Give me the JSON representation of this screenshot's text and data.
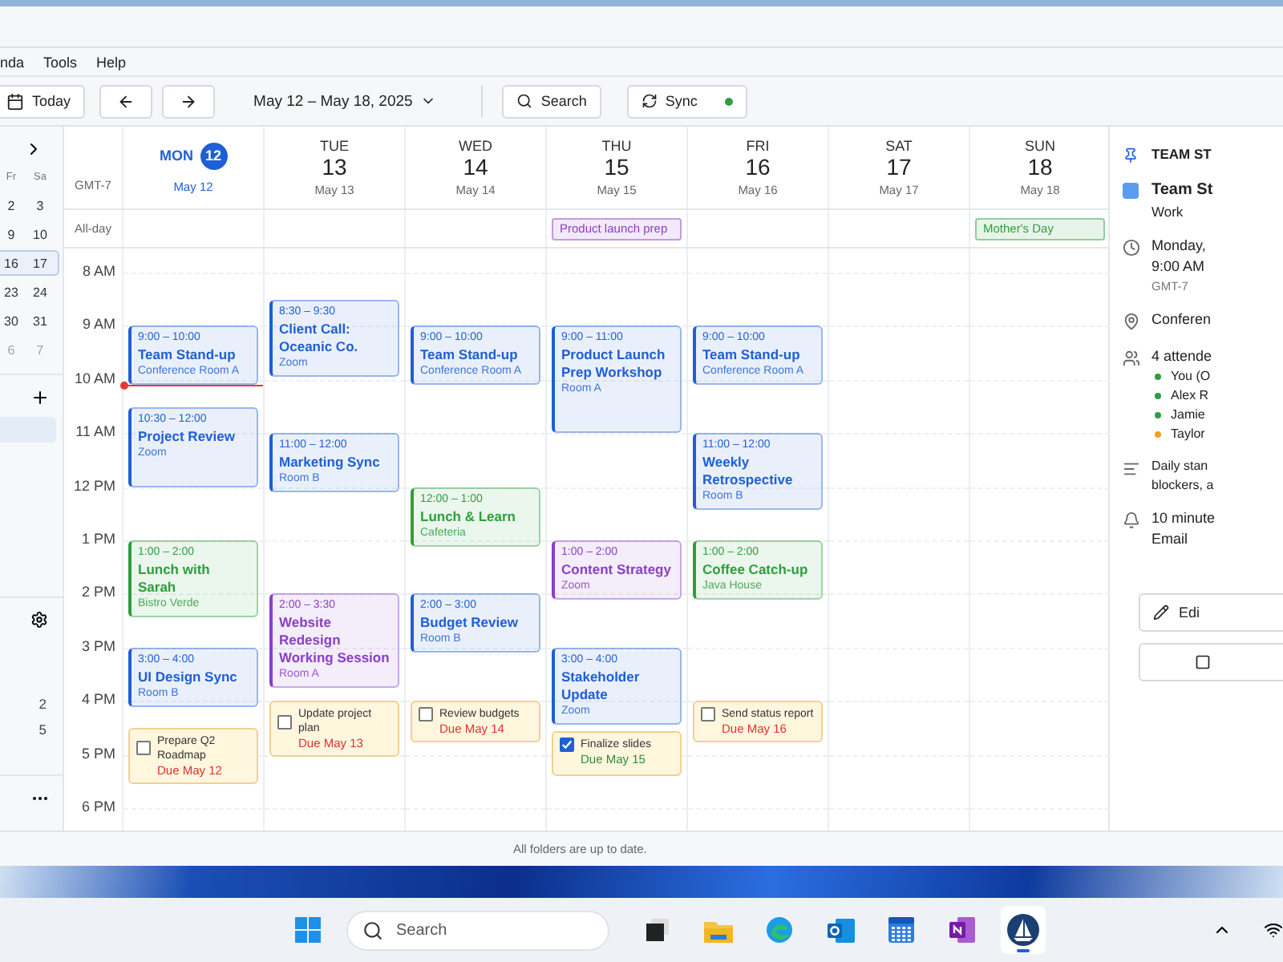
{
  "menu": [
    "nda",
    "Tools",
    "Help"
  ],
  "toolbar": {
    "today": "Today",
    "date_range": "May 12 – May 18, 2025",
    "search": "Search",
    "sync": "Sync",
    "sync_ok": true
  },
  "sidebar": {
    "weekdays": [
      "Fr",
      "Sa"
    ],
    "weeks": [
      {
        "days": [
          "2",
          "3"
        ],
        "selected": false,
        "dimmed": false
      },
      {
        "days": [
          "9",
          "10"
        ],
        "selected": false,
        "dimmed": false
      },
      {
        "days": [
          "16",
          "17"
        ],
        "selected": true,
        "dimmed": false
      },
      {
        "days": [
          "23",
          "24"
        ],
        "selected": false,
        "dimmed": false
      },
      {
        "days": [
          "30",
          "31"
        ],
        "selected": false,
        "dimmed": false
      },
      {
        "days": [
          "6",
          "7"
        ],
        "selected": false,
        "dimmed": true
      }
    ],
    "counts": [
      "2",
      "5"
    ]
  },
  "calendar": {
    "timezone": "GMT-7",
    "allday_label": "All-day",
    "hours": [
      "8 AM",
      "9 AM",
      "10 AM",
      "11 AM",
      "12 PM",
      "1 PM",
      "2 PM",
      "3 PM",
      "4 PM",
      "5 PM",
      "6 PM"
    ],
    "days": [
      {
        "weekday": "MON",
        "number": "12",
        "date": "May 12",
        "selected": true,
        "items": [
          {
            "kind": "event",
            "time": "9:00 – 10:00",
            "title": "Team Stand-up",
            "place": "Conference Room A",
            "color": "#1f5fd6"
          },
          {
            "kind": "event",
            "time": "10:30 – 12:00",
            "title": "Project Review",
            "place": "Zoom",
            "color": "#1f5fd6"
          },
          {
            "kind": "event",
            "time": "1:00 – 2:00",
            "title": "Lunch with Sarah",
            "place": "Bistro Verde",
            "color": "#2e9e3e"
          },
          {
            "kind": "event",
            "time": "3:00 – 4:00",
            "title": "UI Design Sync",
            "place": "Room B",
            "color": "#1f5fd6"
          },
          {
            "kind": "task",
            "title": "Prepare Q2 Roadmap",
            "due": "Due May 12",
            "checked": false
          }
        ]
      },
      {
        "weekday": "TUE",
        "number": "13",
        "date": "May 13",
        "selected": false,
        "items": [
          {
            "kind": "event",
            "time": "8:30 – 9:30",
            "title": "Client Call: Oceanic Co.",
            "place": "Zoom",
            "color": "#1f5fd6"
          },
          {
            "kind": "event",
            "time": "11:00 – 12:00",
            "title": "Marketing Sync",
            "place": "Room B",
            "color": "#1f5fd6"
          },
          {
            "kind": "event",
            "time": "2:00 – 3:30",
            "title": "Website Redesign Working Session",
            "place": "Room A",
            "color": "#8a3fc7"
          },
          {
            "kind": "task",
            "title": "Update project plan",
            "due": "Due May 13",
            "checked": false
          }
        ]
      },
      {
        "weekday": "WED",
        "number": "14",
        "date": "May 14",
        "selected": false,
        "items": [
          {
            "kind": "event",
            "time": "9:00 – 10:00",
            "title": "Team Stand-up",
            "place": "Conference Room A",
            "color": "#1f5fd6"
          },
          {
            "kind": "event",
            "time": "12:00 – 1:00",
            "title": "Lunch & Learn",
            "place": "Cafeteria",
            "color": "#2e9e3e"
          },
          {
            "kind": "event",
            "time": "2:00 – 3:00",
            "title": "Budget Review",
            "place": "Room B",
            "color": "#1f5fd6"
          },
          {
            "kind": "task",
            "title": "Review budgets",
            "due": "Due May 14",
            "checked": false
          }
        ]
      },
      {
        "weekday": "THU",
        "number": "15",
        "date": "May 15",
        "selected": false,
        "allday": {
          "text": "Product launch prep",
          "color": "#8a3fc7"
        },
        "items": [
          {
            "kind": "event",
            "time": "9:00 – 11:00",
            "title": "Product Launch Prep Workshop",
            "place": "Room A",
            "color": "#1f5fd6"
          },
          {
            "kind": "event",
            "time": "1:00 – 2:00",
            "title": "Content Strategy",
            "place": "Zoom",
            "color": "#8a3fc7"
          },
          {
            "kind": "event",
            "time": "3:00 – 4:00",
            "title": "Stakeholder Update",
            "place": "Zoom",
            "color": "#1f5fd6"
          },
          {
            "kind": "task",
            "title": "Finalize slides",
            "due": "Due May 15",
            "checked": true
          }
        ]
      },
      {
        "weekday": "FRI",
        "number": "16",
        "date": "May 16",
        "selected": false,
        "items": [
          {
            "kind": "event",
            "time": "9:00 – 10:00",
            "title": "Team Stand-up",
            "place": "Conference Room A",
            "color": "#1f5fd6"
          },
          {
            "kind": "event",
            "time": "11:00 – 12:00",
            "title": "Weekly Retrospective",
            "place": "Room B",
            "color": "#1f5fd6"
          },
          {
            "kind": "event",
            "time": "1:00 – 2:00",
            "title": "Coffee Catch-up",
            "place": "Java House",
            "color": "#2e9e3e"
          },
          {
            "kind": "task",
            "title": "Send status report",
            "due": "Due May 16",
            "checked": false
          }
        ]
      },
      {
        "weekday": "SAT",
        "number": "17",
        "date": "May 17",
        "selected": false
      },
      {
        "weekday": "SUN",
        "number": "18",
        "date": "May 18",
        "selected": false,
        "allday": {
          "text": "Mother's Day",
          "color": "#2e9e3e"
        }
      }
    ]
  },
  "details": {
    "heading": "TEAM ST",
    "title": "Team St",
    "calendar": "Work",
    "when": [
      "Monday,",
      "9:00 AM"
    ],
    "timezone": "GMT-7",
    "location": "Conferen",
    "attendees_label": "4 attende",
    "attendees": [
      {
        "name": "You (O",
        "color": "#2e9e3e"
      },
      {
        "name": "Alex R",
        "color": "#2e9e3e"
      },
      {
        "name": "Jamie",
        "color": "#2e9e3e"
      },
      {
        "name": "Taylor",
        "color": "#f0a020"
      }
    ],
    "notes": [
      "Daily stan",
      "blockers, a"
    ],
    "reminder": [
      "10 minute",
      "Email"
    ],
    "edit": "Edi"
  },
  "status": "All folders are up to date.",
  "taskbar": {
    "search_placeholder": "Search"
  }
}
